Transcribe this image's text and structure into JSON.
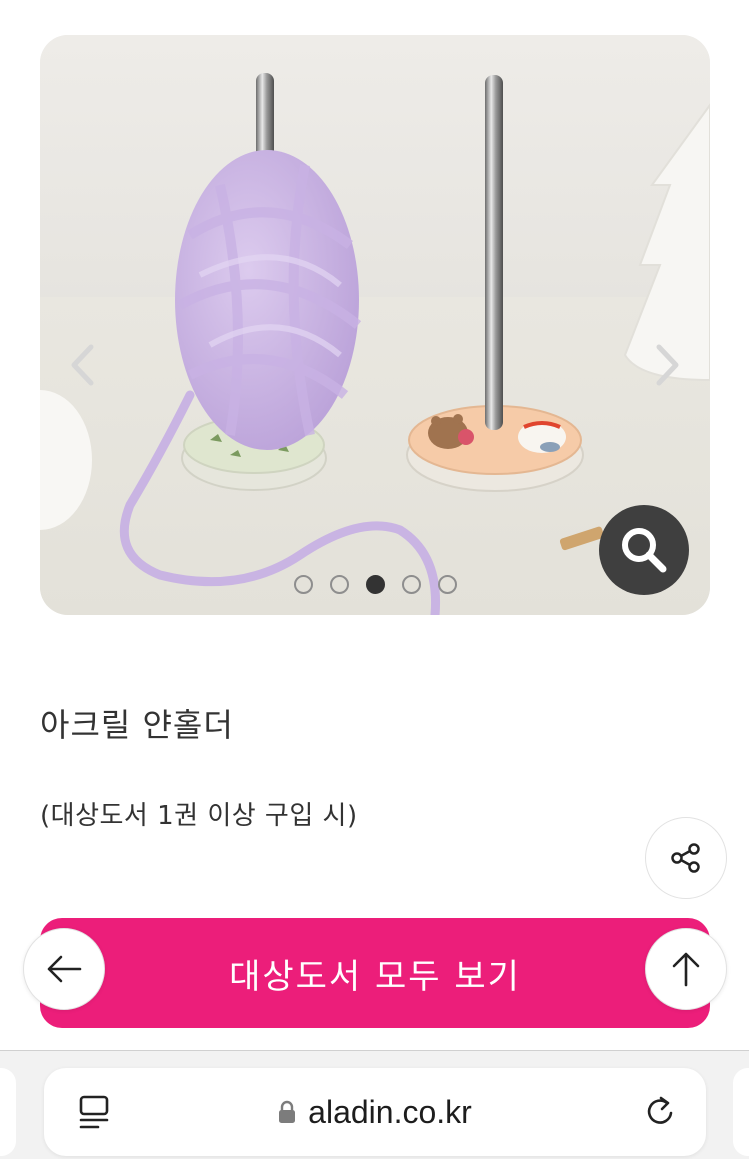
{
  "product": {
    "title": "아크릴 얀홀더",
    "condition": "(대상도서 1권 이상 구입 시)"
  },
  "gallery": {
    "slide_count": 5,
    "active_index": 2
  },
  "cta": {
    "label": "대상도서 모두 보기"
  },
  "browser": {
    "url": "aladin.co.kr"
  },
  "icons": {
    "prev": "chevron-left-icon",
    "next": "chevron-right-icon",
    "zoom": "magnifier-icon",
    "share": "share-icon",
    "back": "arrow-left-icon",
    "top": "arrow-up-icon",
    "reader": "reader-mode-icon",
    "lock": "lock-icon",
    "reload": "reload-icon"
  },
  "colors": {
    "accent": "#ec1e7a",
    "zoom_bg": "#3f3f3f"
  }
}
